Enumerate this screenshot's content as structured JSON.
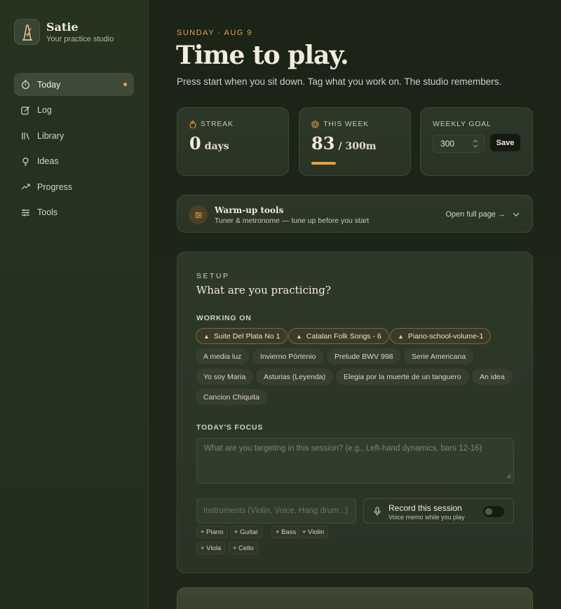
{
  "brand": {
    "name": "Satie",
    "subtitle": "Your practice studio",
    "logo_icon": "metronome-icon"
  },
  "nav": {
    "items": [
      {
        "label": "Today",
        "icon": "stopwatch-icon",
        "active": true
      },
      {
        "label": "Log",
        "icon": "edit-icon"
      },
      {
        "label": "Library",
        "icon": "library-icon"
      },
      {
        "label": "Ideas",
        "icon": "lightbulb-icon"
      },
      {
        "label": "Progress",
        "icon": "trend-up-icon"
      },
      {
        "label": "Tools",
        "icon": "sliders-icon"
      }
    ]
  },
  "header": {
    "date": "SUNDAY · AUG 9",
    "title": "Time to play.",
    "subtitle": "Press start when you sit down. Tag what you work on. The studio remembers."
  },
  "stats": {
    "streak": {
      "label": "STREAK",
      "value": "0",
      "unit": "days"
    },
    "week": {
      "label": "THIS WEEK",
      "value": "83",
      "unit": "/ 300m",
      "progress_fraction": 0.28
    },
    "goal": {
      "label": "WEEKLY GOAL",
      "value": "300",
      "save_label": "Save"
    }
  },
  "warmup": {
    "title": "Warm-up tools",
    "subtitle": "Tuner & metronome — tune up before you start",
    "link": "Open full page →"
  },
  "setup": {
    "kicker": "SETUP",
    "title": "What are you practicing?",
    "working_on_label": "WORKING ON",
    "pinned": [
      "Suite Del Plata No 1",
      "Catalan Folk Songs - 6",
      "Piano-school-volume-1"
    ],
    "pieces": [
      "A media luz",
      "Invierno Pórtenio",
      "Prelude BWV 998",
      "Serie Americana",
      "Yo soy Maria",
      "Asturias (Leyenda)",
      "Elegia por la muerte de un tanguero",
      "An idea",
      "Cancion Chiquita"
    ],
    "focus_label": "TODAY'S FOCUS",
    "focus_placeholder": "What are you targeting in this session? (e.g., Left-hand dynamics, bars 12-16)",
    "instruments_placeholder": "Instruments (Violin, Voice, Hang drum...)",
    "record_title": "Record this session",
    "record_sub": "Voice memo while you play",
    "instrument_chips": [
      "+ Piano",
      "+ Guitar",
      "+ Bass",
      "+ Violin",
      "+ Viola",
      "+ Cello"
    ]
  },
  "colors": {
    "accent": "#e8a23a",
    "background": "#1c2418",
    "sidebar": "#26331f"
  }
}
